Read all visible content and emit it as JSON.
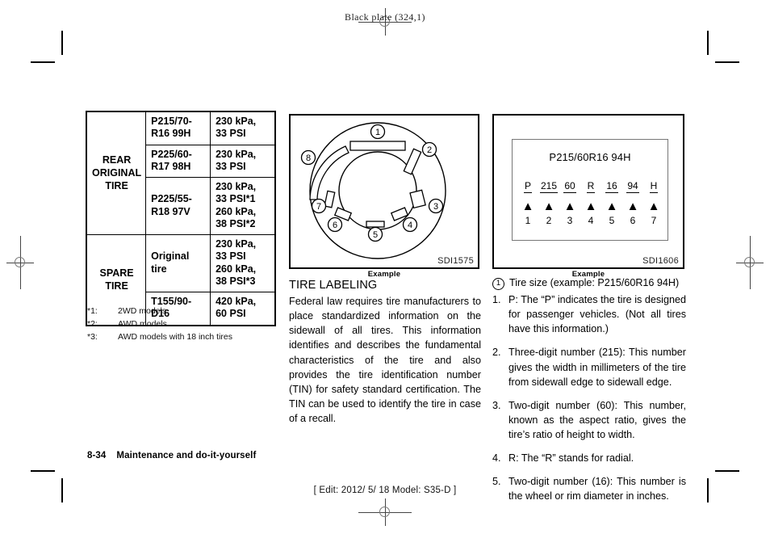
{
  "header": {
    "black_plate": "Black plate (324,1)"
  },
  "footer": {
    "page_number": "8-34",
    "section_title": "Maintenance and do-it-yourself",
    "edit_line": "[ Edit: 2012/ 5/ 18   Model: S35-D ]"
  },
  "spec_table": {
    "rows": [
      {
        "group": "REAR\nORIGINAL\nTIRE",
        "group_rowspan": 3,
        "size": "P215/70-\nR16 99H",
        "pressure": "230 kPa,\n33 PSI"
      },
      {
        "size": "P225/60-\nR17 98H",
        "pressure": "230 kPa,\n33 PSI"
      },
      {
        "size": "P225/55-\nR18 97V",
        "pressure": "230 kPa,\n33 PSI*1\n260 kPa,\n38 PSI*2"
      },
      {
        "group": "SPARE\nTIRE",
        "group_rowspan": 2,
        "size": "Original tire",
        "pressure": "230 kPa,\n33 PSI\n260 kPa,\n38 PSI*3"
      },
      {
        "size": "T155/90-\nD16",
        "pressure": "420 kPa,\n60 PSI"
      }
    ],
    "cells": {
      "g1": "REAR\nORIGINAL\nTIRE",
      "g2": "SPARE\nTIRE",
      "s1": "P215/70-\nR16 99H",
      "s2": "P225/60-\nR17 98H",
      "s3": "P225/55-\nR18 97V",
      "s4": "Original tire",
      "s5": "T155/90-\nD16",
      "p1": "230 kPa,\n33 PSI",
      "p2": "230 kPa,\n33 PSI",
      "p3": "230 kPa,\n33 PSI*1\n260 kPa,\n38 PSI*2",
      "p4": "230 kPa,\n33 PSI\n260 kPa,\n38 PSI*3",
      "p5": "420 kPa,\n60 PSI"
    }
  },
  "footnotes": [
    {
      "marker": "*1:",
      "text": "2WD models"
    },
    {
      "marker": "*2:",
      "text": "AWD models"
    },
    {
      "marker": "*3:",
      "text": "AWD models with 18 inch tires"
    }
  ],
  "figures": {
    "tire_sidewall": {
      "code": "SDI1575",
      "caption": "Example",
      "callouts": [
        "1",
        "2",
        "3",
        "4",
        "5",
        "6",
        "7",
        "8"
      ]
    },
    "tire_label": {
      "code": "SDI1606",
      "caption": "Example",
      "size_text": "P215/60R16 94H",
      "segments": [
        {
          "code": "P",
          "index": "1"
        },
        {
          "code": "215",
          "index": "2"
        },
        {
          "code": "60",
          "index": "3"
        },
        {
          "code": "R",
          "index": "4"
        },
        {
          "code": "16",
          "index": "5"
        },
        {
          "code": "94",
          "index": "6"
        },
        {
          "code": "H",
          "index": "7"
        }
      ]
    }
  },
  "middle_column": {
    "section_title": "TIRE LABELING",
    "paragraph": "Federal law requires tire manufacturers to place standardized information on the sidewall of all tires. This information identifies and describes the fundamental characteristics of the tire and also provides the tire identification number (TIN) for safety standard certification. The TIN can be used to identify the tire in case of a recall."
  },
  "right_column": {
    "circled_marker": "1",
    "tire_size_heading": "Tire size (example: P215/60R16 94H)",
    "items": [
      {
        "n": "1.",
        "text": "P: The “P” indicates the tire is designed for passenger vehicles. (Not all tires have this information.)"
      },
      {
        "n": "2.",
        "text": "Three-digit number (215): This number gives the width in millimeters of the tire from sidewall edge to sidewall edge."
      },
      {
        "n": "3.",
        "text": "Two-digit number (60): This number, known as the aspect ratio, gives the tire’s ratio of height to width."
      },
      {
        "n": "4.",
        "text": "R: The “R” stands for radial."
      },
      {
        "n": "5.",
        "text": "Two-digit number (16): This number is the wheel or rim diameter in inches."
      }
    ]
  },
  "colors": {
    "ink": "#000000",
    "paper": "#ffffff",
    "reg_mark": "#666666"
  }
}
